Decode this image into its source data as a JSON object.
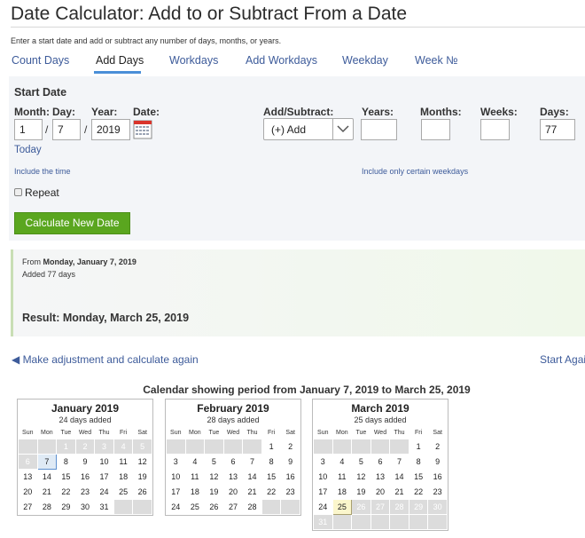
{
  "page": {
    "title": "Date Calculator: Add to or Subtract From a Date",
    "intro": "Enter a start date and add or subtract any number of days, months, or years."
  },
  "tabs": [
    {
      "label": "Count Days"
    },
    {
      "label": "Add Days",
      "active": true
    },
    {
      "label": "Workdays"
    },
    {
      "label": "Add Workdays"
    },
    {
      "label": "Weekday"
    },
    {
      "label": "Week №"
    }
  ],
  "form": {
    "heading": "Start Date",
    "month_label": "Month:",
    "day_label": "Day:",
    "year_label": "Year:",
    "date_label": "Date:",
    "month_value": "1",
    "day_value": "7",
    "year_value": "2019",
    "separator": "/",
    "today_link": "Today",
    "include_time_link": "Include the time",
    "add_subtract_label": "Add/Subtract:",
    "add_subtract_value": "(+) Add",
    "years_label": "Years:",
    "months_label": "Months:",
    "weeks_label": "Weeks:",
    "days_label": "Days:",
    "years_value": "",
    "months_value": "",
    "weeks_value": "",
    "days_value": "77",
    "weekdays_link": "Include only certain weekdays",
    "repeat_label": "Repeat",
    "calculate_button": "Calculate New Date"
  },
  "result": {
    "from_prefix": "From ",
    "from_date": "Monday, January 7, 2019",
    "added": "Added 77 days",
    "result_line": "Result: Monday, March 25, 2019"
  },
  "nav": {
    "adjust_link": "◀ Make adjustment and calculate again",
    "start_again_link": "Start Again"
  },
  "calendar": {
    "caption": "Calendar showing period from January 7, 2019 to March 25, 2019",
    "weekdays": [
      "Sun",
      "Mon",
      "Tue",
      "Wed",
      "Thu",
      "Fri",
      "Sat"
    ],
    "months": [
      {
        "name": "January 2019",
        "sub": "24 days added",
        "weeks": [
          [
            "",
            "",
            "1",
            "2",
            "3",
            "4",
            "5"
          ],
          [
            "6",
            "7",
            "8",
            "9",
            "10",
            "11",
            "12"
          ],
          [
            "13",
            "14",
            "15",
            "16",
            "17",
            "18",
            "19"
          ],
          [
            "20",
            "21",
            "22",
            "23",
            "24",
            "25",
            "26"
          ],
          [
            "27",
            "28",
            "29",
            "30",
            "31",
            "",
            ""
          ]
        ],
        "out_days": [
          "1",
          "2",
          "3",
          "4",
          "5",
          "6"
        ],
        "start_day": "7"
      },
      {
        "name": "February 2019",
        "sub": "28 days added",
        "weeks": [
          [
            "",
            "",
            "",
            "",
            "",
            "1",
            "2"
          ],
          [
            "3",
            "4",
            "5",
            "6",
            "7",
            "8",
            "9"
          ],
          [
            "10",
            "11",
            "12",
            "13",
            "14",
            "15",
            "16"
          ],
          [
            "17",
            "18",
            "19",
            "20",
            "21",
            "22",
            "23"
          ],
          [
            "24",
            "25",
            "26",
            "27",
            "28",
            "",
            ""
          ]
        ],
        "out_days": []
      },
      {
        "name": "March 2019",
        "sub": "25 days added",
        "weeks": [
          [
            "",
            "",
            "",
            "",
            "",
            "1",
            "2"
          ],
          [
            "3",
            "4",
            "5",
            "6",
            "7",
            "8",
            "9"
          ],
          [
            "10",
            "11",
            "12",
            "13",
            "14",
            "15",
            "16"
          ],
          [
            "17",
            "18",
            "19",
            "20",
            "21",
            "22",
            "23"
          ],
          [
            "24",
            "25",
            "26",
            "27",
            "28",
            "29",
            "30"
          ],
          [
            "31",
            "",
            "",
            "",
            "",
            "",
            ""
          ]
        ],
        "out_days": [
          "26",
          "27",
          "28",
          "29",
          "30",
          "31"
        ],
        "end_day": "25"
      }
    ]
  },
  "colors": {
    "link": "#3d5b9a",
    "tab_underline": "#4a8fd8",
    "button": "#5aa61f",
    "calendar_icon_top": "#d9342b"
  }
}
